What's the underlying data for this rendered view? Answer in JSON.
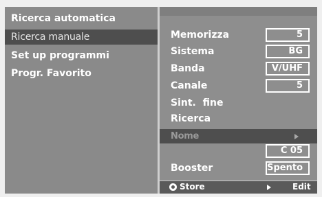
{
  "left_menu": {
    "items": [
      {
        "label": "Ricerca automatica"
      },
      {
        "label": "Ricerca manuale"
      },
      {
        "label": "Set up programmi"
      },
      {
        "label": "Progr. Favorito"
      }
    ]
  },
  "right_panel": {
    "rows": [
      {
        "label": "Memorizza",
        "value": "5"
      },
      {
        "label": "Sistema",
        "value": "BG"
      },
      {
        "label": "Banda",
        "value": "V/UHF"
      },
      {
        "label": "Canale",
        "value": "5"
      },
      {
        "label": "Sint.  fine"
      },
      {
        "label": "Ricerca"
      },
      {
        "label": "Nome"
      },
      {
        "label": "",
        "value": "C 05"
      },
      {
        "label": "Booster",
        "value": "Spento"
      }
    ]
  },
  "footer": {
    "store_label": "Store",
    "edit_label": "Edit"
  },
  "icons": {
    "store": "circle-button-icon",
    "edit": "play-arrow-icon",
    "nome": "right-arrow-icon"
  },
  "colors": {
    "menu_bg": "#8a8a8a",
    "highlight_bg": "#4e4e4e",
    "panel_bg": "#8e8e8e",
    "text": "#ffffff"
  }
}
